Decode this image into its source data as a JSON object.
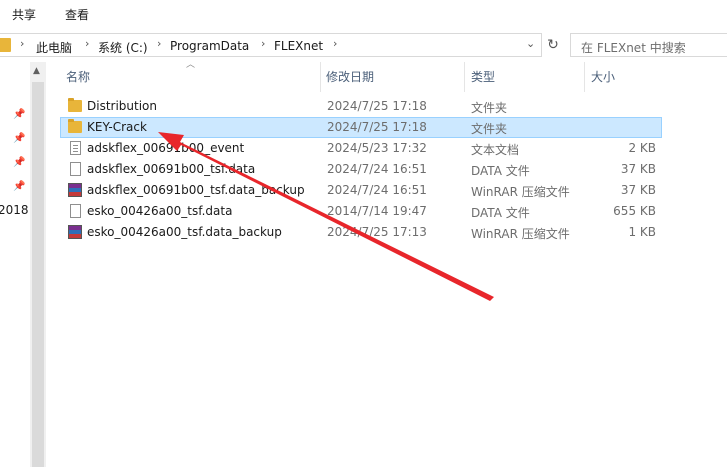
{
  "ribbon": {
    "tabs": [
      "共享",
      "查看"
    ]
  },
  "address": {
    "crumbs": [
      "此电脑",
      "系统 (C:)",
      "ProgramData",
      "FLEXnet"
    ],
    "search_placeholder": "在 FLEXnet 中搜索"
  },
  "nav": {
    "year_label": "2018"
  },
  "columns": {
    "name": "名称",
    "date": "修改日期",
    "type": "类型",
    "size": "大小"
  },
  "files": [
    {
      "name": "Distribution",
      "date": "2024/7/25 17:18",
      "type": "文件夹",
      "size": "",
      "icon": "folder-icon",
      "selected": false
    },
    {
      "name": "KEY-Crack",
      "date": "2024/7/25 17:18",
      "type": "文件夹",
      "size": "",
      "icon": "folder-icon",
      "selected": true
    },
    {
      "name": "adskflex_00691b00_event",
      "date": "2024/5/23 17:32",
      "type": "文本文档",
      "size": "2 KB",
      "icon": "text-file-icon",
      "selected": false
    },
    {
      "name": "adskflex_00691b00_tsf.data",
      "date": "2024/7/24 16:51",
      "type": "DATA 文件",
      "size": "37 KB",
      "icon": "file-icon",
      "selected": false
    },
    {
      "name": "adskflex_00691b00_tsf.data_backup",
      "date": "2024/7/24 16:51",
      "type": "WinRAR 压缩文件",
      "size": "37 KB",
      "icon": "winrar-icon",
      "selected": false
    },
    {
      "name": "esko_00426a00_tsf.data",
      "date": "2014/7/14 19:47",
      "type": "DATA 文件",
      "size": "655 KB",
      "icon": "file-icon",
      "selected": false
    },
    {
      "name": "esko_00426a00_tsf.data_backup",
      "date": "2024/7/25 17:13",
      "type": "WinRAR 压缩文件",
      "size": "1 KB",
      "icon": "winrar-icon",
      "selected": false
    }
  ],
  "annotation": {
    "arrow_color": "#e8262b"
  }
}
